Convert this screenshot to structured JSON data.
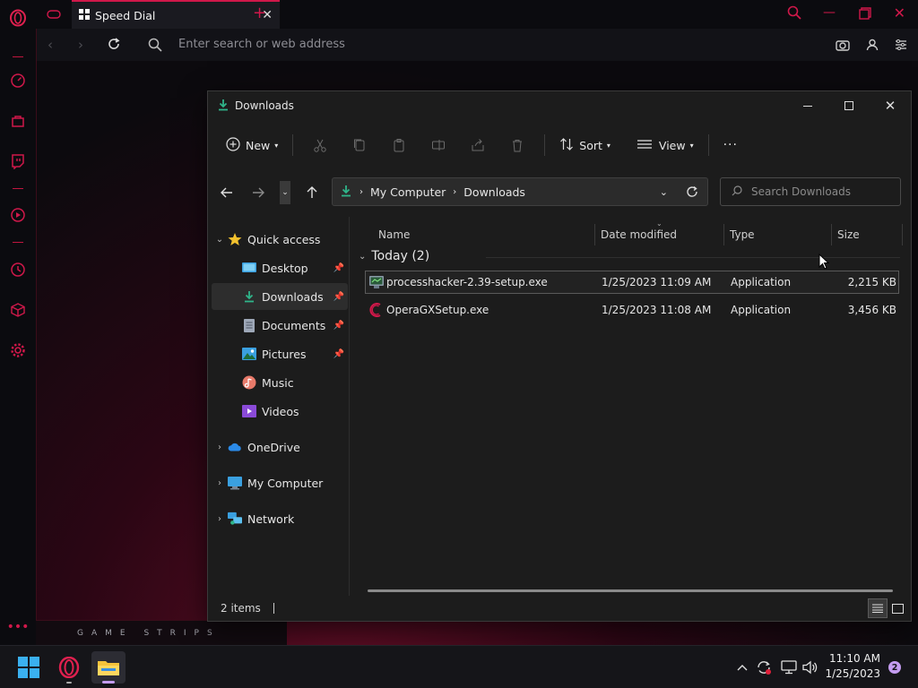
{
  "browser": {
    "tab_title": "Speed Dial",
    "address_placeholder": "Enter search or web address",
    "strip_label": "GAME STRIPS",
    "accent_color": "#d0184a"
  },
  "explorer": {
    "title": "Downloads",
    "toolbar": {
      "new_label": "New",
      "sort_label": "Sort",
      "view_label": "View",
      "more_label": "···"
    },
    "breadcrumb": [
      "My Computer",
      "Downloads"
    ],
    "search_placeholder": "Search Downloads",
    "nav": {
      "quick_access": "Quick access",
      "pinned": [
        {
          "label": "Desktop",
          "icon": "desktop-icon"
        },
        {
          "label": "Downloads",
          "icon": "download-icon"
        },
        {
          "label": "Documents",
          "icon": "document-icon"
        },
        {
          "label": "Pictures",
          "icon": "picture-icon"
        }
      ],
      "unpinned": [
        {
          "label": "Music",
          "icon": "music-icon"
        },
        {
          "label": "Videos",
          "icon": "video-icon"
        }
      ],
      "roots": [
        {
          "label": "OneDrive",
          "icon": "cloud-icon"
        },
        {
          "label": "My Computer",
          "icon": "computer-icon"
        },
        {
          "label": "Network",
          "icon": "network-icon"
        }
      ]
    },
    "columns": {
      "name": "Name",
      "date": "Date modified",
      "type": "Type",
      "size": "Size"
    },
    "group_label": "Today (2)",
    "files": [
      {
        "name": "processhacker-2.39-setup.exe",
        "date": "1/25/2023 11:09 AM",
        "type": "Application",
        "size": "2,215 KB"
      },
      {
        "name": "OperaGXSetup.exe",
        "date": "1/25/2023 11:08 AM",
        "type": "Application",
        "size": "3,456 KB"
      }
    ],
    "status_text": "2 items"
  },
  "taskbar": {
    "time": "11:10 AM",
    "date": "1/25/2023",
    "notification_count": "2"
  }
}
